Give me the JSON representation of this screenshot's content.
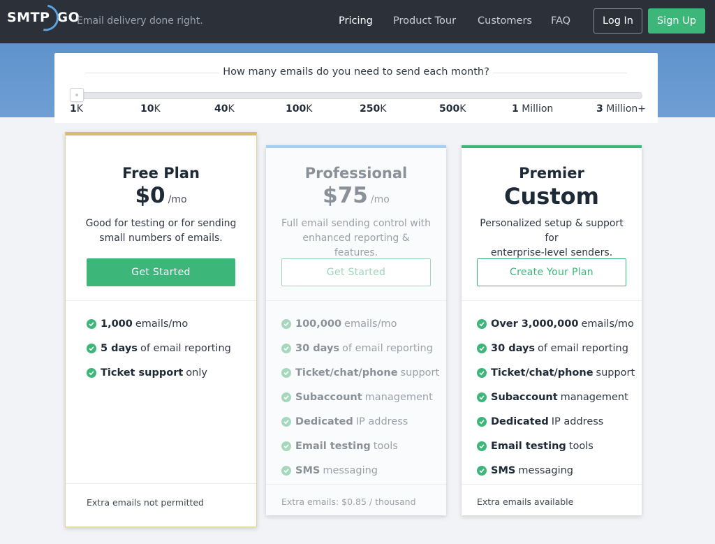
{
  "nav": {
    "logo": "SMTP",
    "logo_suffix": "GO",
    "tagline": "Email delivery done right.",
    "links": [
      "Pricing",
      "Product Tour",
      "Customers",
      "FAQ"
    ],
    "login": "Log In",
    "signup": "Sign Up"
  },
  "slider": {
    "question": "How many emails do you need to send each month?",
    "selected_index": 0,
    "ticks": [
      {
        "value": "1",
        "unit": "K"
      },
      {
        "value": "10",
        "unit": "K"
      },
      {
        "value": "40",
        "unit": "K"
      },
      {
        "value": "100",
        "unit": "K"
      },
      {
        "value": "250",
        "unit": "K"
      },
      {
        "value": "500",
        "unit": "K"
      },
      {
        "value": "1",
        "unit": " Million"
      },
      {
        "value": "3",
        "unit": " Million+"
      }
    ]
  },
  "plans": [
    {
      "title": "Free Plan",
      "price": "$0",
      "unit": "/mo",
      "desc": [
        "Good for testing or for sending",
        "small numbers of emails."
      ],
      "cta": "Get Started",
      "features": [
        {
          "bold": "1,000",
          "rest": "emails/mo"
        },
        {
          "bold": "5 days",
          "rest": "of email reporting"
        },
        {
          "bold": "Ticket support",
          "rest": "only"
        }
      ],
      "footer": "Extra emails not permitted"
    },
    {
      "title": "Professional",
      "price": "$75",
      "unit": "/mo",
      "desc": [
        "Full email sending control with",
        "enhanced reporting & features."
      ],
      "cta": "Get Started",
      "features": [
        {
          "bold": "100,000",
          "rest": "emails/mo"
        },
        {
          "bold": "30 days",
          "rest": "of email reporting"
        },
        {
          "bold": "Ticket/chat/phone",
          "rest": "support"
        },
        {
          "bold": "Subaccount",
          "rest": "management"
        },
        {
          "bold": "Dedicated",
          "rest": "IP address"
        },
        {
          "bold": "Email testing",
          "rest": "tools"
        },
        {
          "bold": "SMS",
          "rest": "messaging"
        }
      ],
      "footer": "Extra emails: $0.85 / thousand"
    },
    {
      "title": "Premier",
      "price": "Custom",
      "unit": "",
      "desc": [
        "Personalized setup & support for",
        "enterprise-level senders."
      ],
      "cta": "Create Your Plan",
      "features": [
        {
          "bold": "Over 3,000,000",
          "rest": "emails/mo"
        },
        {
          "bold": "30 days",
          "rest": "of email reporting"
        },
        {
          "bold": "Ticket/chat/phone",
          "rest": "support"
        },
        {
          "bold": "Subaccount",
          "rest": "management"
        },
        {
          "bold": "Dedicated",
          "rest": "IP address"
        },
        {
          "bold": "Email testing",
          "rest": "tools"
        },
        {
          "bold": "SMS",
          "rest": "messaging"
        }
      ],
      "footer": "Extra emails available"
    }
  ],
  "colors": {
    "nav_bg": "#2b3039",
    "accent_green": "#3db67a",
    "band_blue": "#5f93cc",
    "free_border": "#d8bd6c",
    "pro_border": "#a7cdf0"
  }
}
